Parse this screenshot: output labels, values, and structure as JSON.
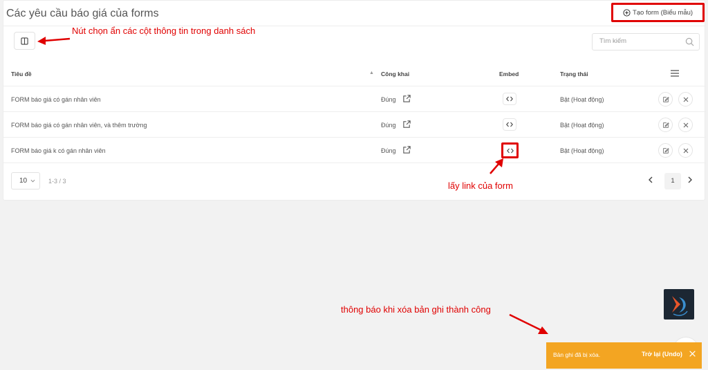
{
  "page": {
    "title": "Các yêu cầu báo giá của forms"
  },
  "toolbar": {
    "create_label": "Tạo form (Biểu mẫu)"
  },
  "search": {
    "placeholder": "Tìm kiếm"
  },
  "table": {
    "columns": {
      "title": "Tiêu đề",
      "public": "Công khai",
      "embed": "Embed",
      "status": "Trạng thái"
    },
    "rows": [
      {
        "title": "FORM báo giá có gán nhân viên",
        "public": "Đúng",
        "status": "Bật (Hoạt động)"
      },
      {
        "title": "FORM báo giá có gán nhân viên, và thêm trường",
        "public": "Đúng",
        "status": "Bật (Hoạt động)"
      },
      {
        "title": "FORM báo giá k có gán nhân viên",
        "public": "Đúng",
        "status": "Bật (Hoạt động)"
      }
    ]
  },
  "pagination": {
    "page_size": "10",
    "range": "1-3 / 3",
    "current_page": "1"
  },
  "annotations": {
    "columns_note": "Nút chọn ẩn các cột thông tin trong danh sách",
    "embed_note": "lấy link của form",
    "toast_note": "thông báo khi xóa bản ghi thành công"
  },
  "toast": {
    "message": "Bản ghi đã bị xóa.",
    "undo": "Trở lại (Undo)"
  },
  "colors": {
    "annotation": "#e00000",
    "toast_bg": "#f3a522"
  }
}
